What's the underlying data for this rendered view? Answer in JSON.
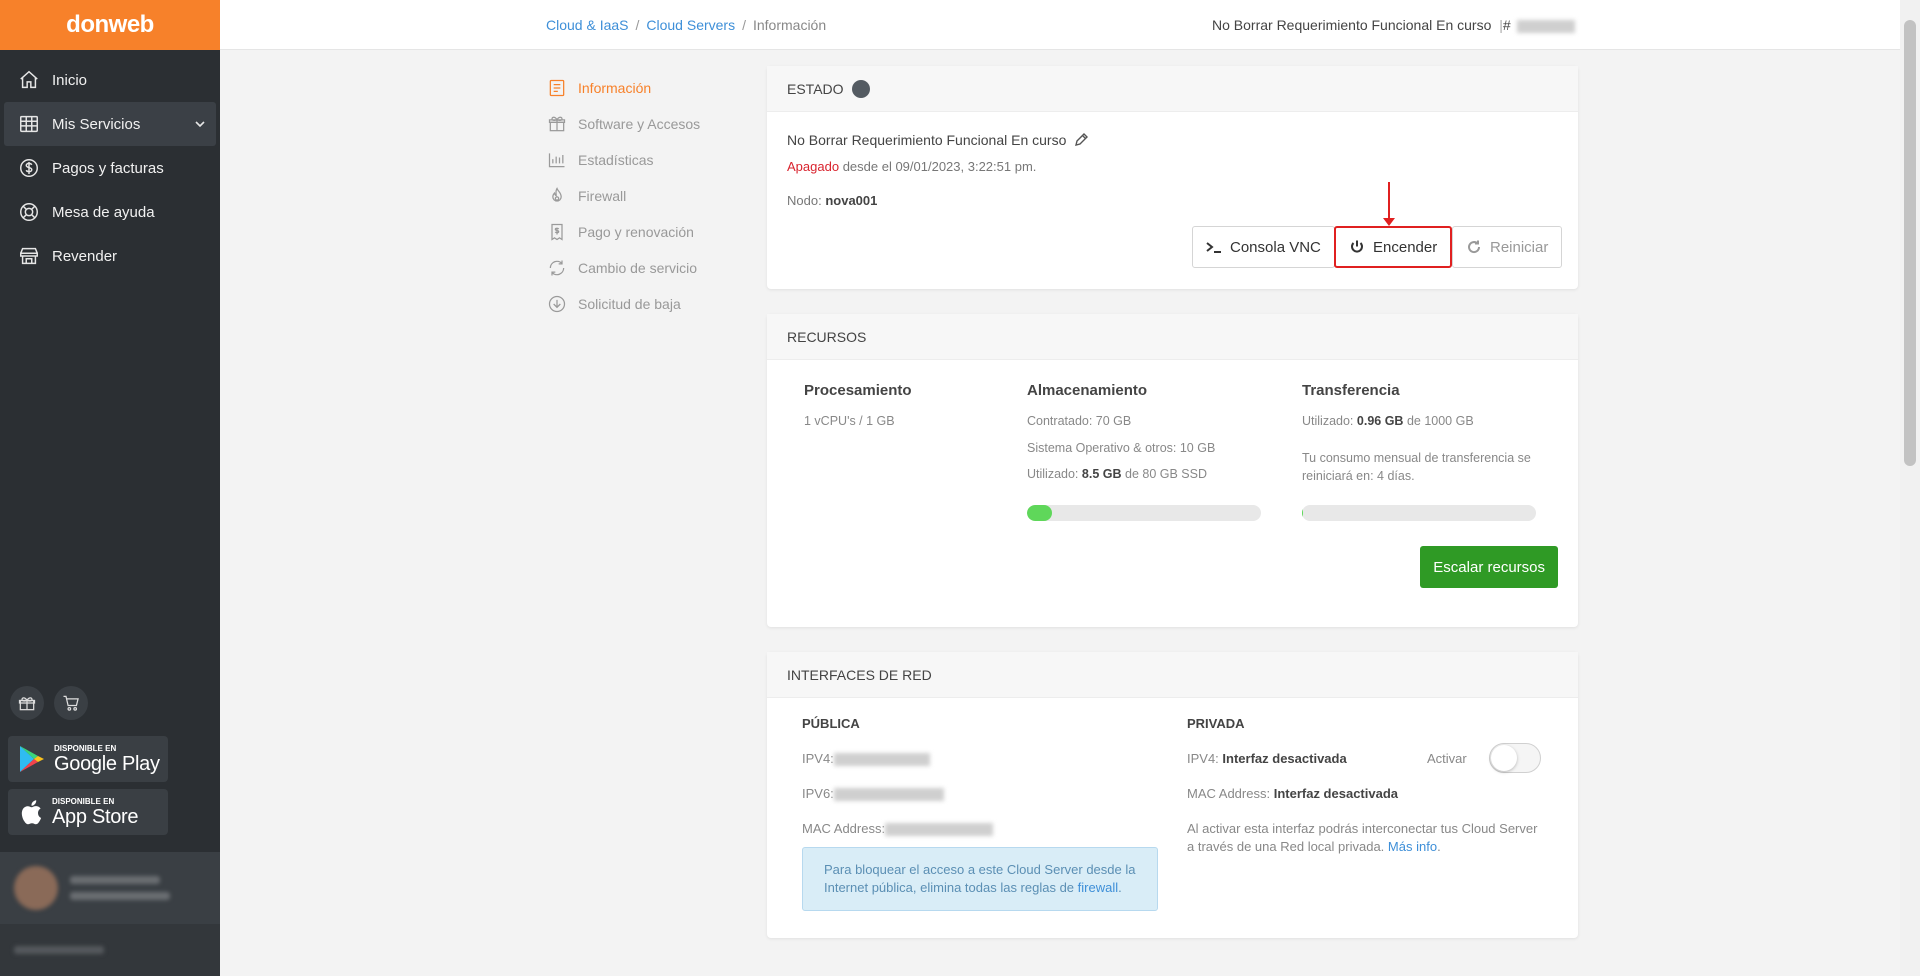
{
  "sidebar": {
    "logo": "donweb",
    "items": [
      {
        "label": "Inicio",
        "icon": "home-icon"
      },
      {
        "label": "Mis Servicios",
        "icon": "grid-icon"
      },
      {
        "label": "Pagos y facturas",
        "icon": "dollar-circle-icon"
      },
      {
        "label": "Mesa de ayuda",
        "icon": "lifebuoy-icon"
      },
      {
        "label": "Revender",
        "icon": "store-icon"
      }
    ],
    "google_play": {
      "small": "DISPONIBLE EN",
      "big": "Google Play"
    },
    "app_store": {
      "small": "DISPONIBLE EN",
      "big": "App Store"
    }
  },
  "breadcrumb": {
    "item1": "Cloud & IaaS",
    "item2": "Cloud Servers",
    "current": "Información"
  },
  "header": {
    "server_name": "No Borrar Requerimiento Funcional En curso",
    "id_prefix": "#"
  },
  "submenu": [
    {
      "label": "Información",
      "icon": "document-icon",
      "active": true
    },
    {
      "label": "Software y Accesos",
      "icon": "gift-box-icon"
    },
    {
      "label": "Estadísticas",
      "icon": "bar-chart-icon"
    },
    {
      "label": "Firewall",
      "icon": "flame-icon"
    },
    {
      "label": "Pago y renovación",
      "icon": "invoice-icon"
    },
    {
      "label": "Cambio de servicio",
      "icon": "refresh-icon"
    },
    {
      "label": "Solicitud de baja",
      "icon": "arrow-down-circle-icon"
    }
  ],
  "estado": {
    "title": "ESTADO",
    "server_name": "No Borrar Requerimiento Funcional En curso",
    "status": "Apagado",
    "since": "desde el 09/01/2023, 3:22:51 pm.",
    "node_label": "Nodo:",
    "node_value": "nova001",
    "buttons": {
      "vnc": "Consola VNC",
      "power_on": "Encender",
      "restart": "Reiniciar"
    }
  },
  "recursos": {
    "title": "RECURSOS",
    "procesamiento": {
      "title": "Procesamiento",
      "value": "1 vCPU's / 1 GB"
    },
    "almacenamiento": {
      "title": "Almacenamiento",
      "contratado": "Contratado: 70 GB",
      "sistema": "Sistema Operativo & otros: 10 GB",
      "utilizado_prefix": "Utilizado:",
      "utilizado_value": "8.5 GB",
      "utilizado_suffix": "de 80 GB SSD",
      "fill_fraction": 0.106
    },
    "transferencia": {
      "title": "Transferencia",
      "utilizado_prefix": "Utilizado:",
      "utilizado_value": "0.96 GB",
      "utilizado_suffix": "de 1000 GB",
      "note": "Tu consumo mensual de transferencia se reiniciará en: 4 días.",
      "fill_fraction": 0.001
    },
    "scale_button": "Escalar recursos"
  },
  "red": {
    "title": "INTERFACES DE RED",
    "publica": {
      "title": "PÚBLICA",
      "ipv4_label": "IPV4:",
      "ipv6_label": "IPV6:",
      "mac_label": "MAC Address:",
      "info_text": "Para bloquear el acceso a este Cloud Server desde la Internet pública, elimina todas las reglas de",
      "info_link": "firewall",
      "info_end": "."
    },
    "privada": {
      "title": "PRIVADA",
      "ipv4_label": "IPV4:",
      "ipv4_value": "Interfaz desactivada",
      "mac_label": "MAC Address:",
      "mac_value": "Interfaz desactivada",
      "toggle_label": "Activar",
      "toggle_on": false,
      "note": "Al activar esta interfaz podrás interconectar tus Cloud Server a través de una Red local privada.",
      "note_link": "Más info"
    }
  }
}
